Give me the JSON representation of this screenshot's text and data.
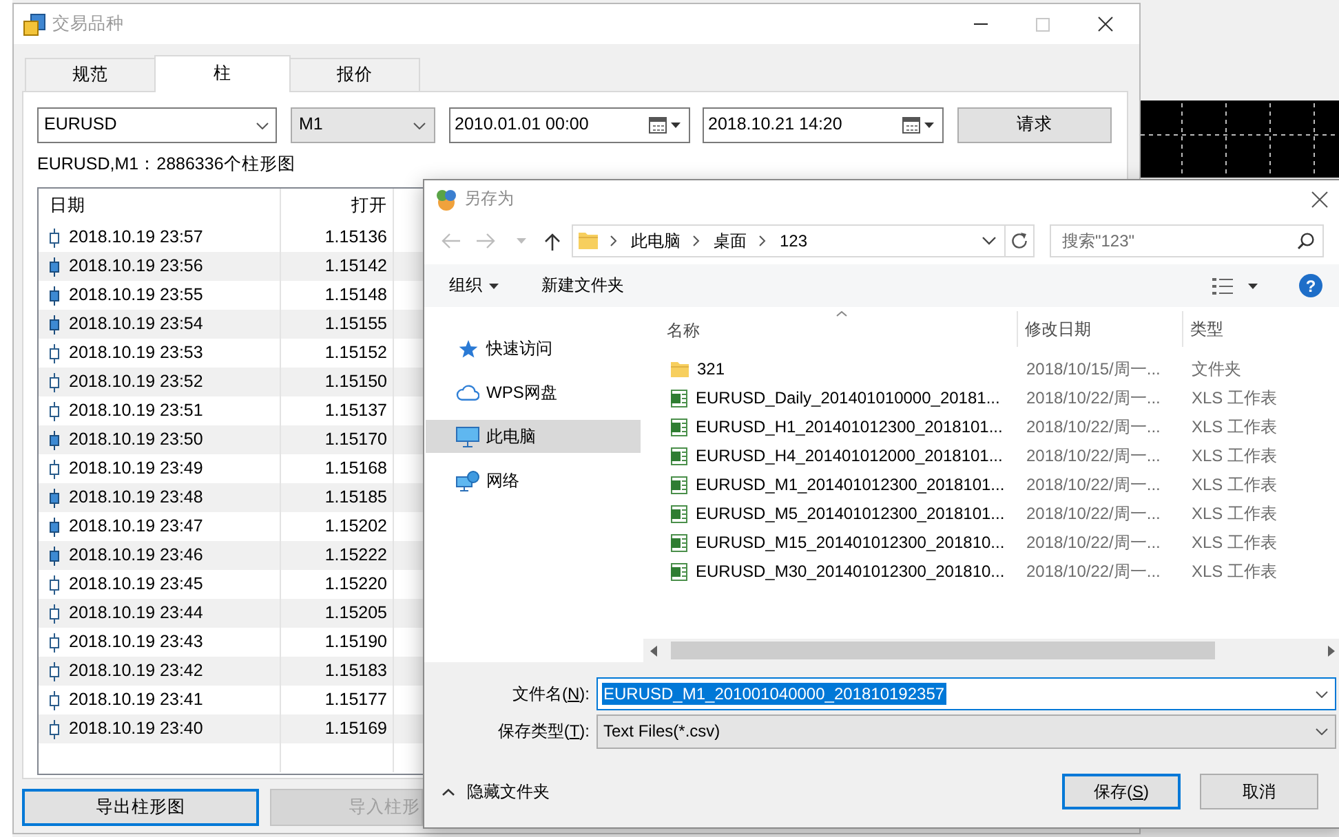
{
  "symbols_dialog": {
    "title": "交易品种",
    "tabs": [
      {
        "label": "规范",
        "selected": false
      },
      {
        "label": "柱",
        "selected": true
      },
      {
        "label": "报价",
        "selected": false
      }
    ],
    "symbol": "EURUSD",
    "timeframe": "M1",
    "date_from": "2010.01.01 00:00",
    "date_to": "2018.10.21 14:20",
    "request_button": "请求",
    "summary": "EURUSD,M1：2886336个柱形图",
    "table": {
      "columns": [
        "日期",
        "打开"
      ],
      "rows": [
        {
          "date": "2018.10.19 23:57",
          "open": "1.15136",
          "filled": false,
          "selected": false
        },
        {
          "date": "2018.10.19 23:56",
          "open": "1.15142",
          "filled": true,
          "selected": false
        },
        {
          "date": "2018.10.19 23:55",
          "open": "1.15148",
          "filled": true,
          "selected": false
        },
        {
          "date": "2018.10.19 23:54",
          "open": "1.15155",
          "filled": true,
          "selected": false
        },
        {
          "date": "2018.10.19 23:53",
          "open": "1.15152",
          "filled": false,
          "selected": false
        },
        {
          "date": "2018.10.19 23:52",
          "open": "1.15150",
          "filled": false,
          "selected": false
        },
        {
          "date": "2018.10.19 23:51",
          "open": "1.15137",
          "filled": false,
          "selected": false
        },
        {
          "date": "2018.10.19 23:50",
          "open": "1.15170",
          "filled": true,
          "selected": false
        },
        {
          "date": "2018.10.19 23:49",
          "open": "1.15168",
          "filled": false,
          "selected": false
        },
        {
          "date": "2018.10.19 23:48",
          "open": "1.15185",
          "filled": true,
          "selected": false
        },
        {
          "date": "2018.10.19 23:47",
          "open": "1.15202",
          "filled": true,
          "selected": false
        },
        {
          "date": "2018.10.19 23:46",
          "open": "1.15222",
          "filled": true,
          "selected": false
        },
        {
          "date": "2018.10.19 23:45",
          "open": "1.15220",
          "filled": false,
          "selected": false
        },
        {
          "date": "2018.10.19 23:44",
          "open": "1.15205",
          "filled": false,
          "selected": false
        },
        {
          "date": "2018.10.19 23:43",
          "open": "1.15190",
          "filled": false,
          "selected": false
        },
        {
          "date": "2018.10.19 23:42",
          "open": "1.15183",
          "filled": false,
          "selected": false
        },
        {
          "date": "2018.10.19 23:41",
          "open": "1.15177",
          "filled": false,
          "selected": false
        },
        {
          "date": "2018.10.19 23:40",
          "open": "1.15169",
          "filled": false,
          "selected": false
        }
      ]
    },
    "buttons": [
      {
        "label": "导出柱形图",
        "focused": true,
        "disabled": false
      },
      {
        "label": "导入柱形",
        "focused": false,
        "disabled": true
      }
    ]
  },
  "save_dialog": {
    "title": "另存为",
    "path": [
      "此电脑",
      "桌面",
      "123"
    ],
    "search": {
      "placeholder": "搜索\"123\""
    },
    "toolbar": {
      "organize": "组织",
      "new_folder": "新建文件夹",
      "help": "?"
    },
    "nav": [
      {
        "label": "快速访问",
        "kind": "star",
        "selected": false
      },
      {
        "label": "WPS网盘",
        "kind": "cloud",
        "selected": false
      },
      {
        "label": "此电脑",
        "kind": "computer",
        "selected": true
      },
      {
        "label": "网络",
        "kind": "network",
        "selected": false
      }
    ],
    "columns": [
      "名称",
      "修改日期",
      "类型"
    ],
    "files": [
      {
        "kind": "folder",
        "name": "321",
        "modified": "2018/10/15/周一...",
        "type": "文件夹"
      },
      {
        "kind": "spreadsheet",
        "name": "EURUSD_Daily_201401010000_20181...",
        "modified": "2018/10/22/周一...",
        "type": "XLS 工作表"
      },
      {
        "kind": "spreadsheet",
        "name": "EURUSD_H1_201401012300_2018101...",
        "modified": "2018/10/22/周一...",
        "type": "XLS 工作表"
      },
      {
        "kind": "spreadsheet",
        "name": "EURUSD_H4_201401012000_2018101...",
        "modified": "2018/10/22/周一...",
        "type": "XLS 工作表"
      },
      {
        "kind": "spreadsheet",
        "name": "EURUSD_M1_201401012300_2018101...",
        "modified": "2018/10/22/周一...",
        "type": "XLS 工作表"
      },
      {
        "kind": "spreadsheet",
        "name": "EURUSD_M5_201401012300_2018101...",
        "modified": "2018/10/22/周一...",
        "type": "XLS 工作表"
      },
      {
        "kind": "spreadsheet",
        "name": "EURUSD_M15_201401012300_201810...",
        "modified": "2018/10/22/周一...",
        "type": "XLS 工作表"
      },
      {
        "kind": "spreadsheet",
        "name": "EURUSD_M30_201401012300_201810...",
        "modified": "2018/10/22/周一...",
        "type": "XLS 工作表"
      }
    ],
    "file_name": {
      "label_start": "文件名(",
      "access_key": "N",
      "label_end": "):",
      "value": "EURUSD_M1_201001040000_201810192357",
      "value_selected": true
    },
    "file_type": {
      "label_start": "保存类型(",
      "access_key": "T",
      "label_end": "):",
      "value": "Text Files(*.csv)"
    },
    "hide_folders": "隐藏文件夹",
    "save_button": {
      "label_start": "保存(",
      "access_key": "S",
      "label_end": ")",
      "focused": true
    },
    "cancel_button": {
      "label": "取消",
      "focused": false
    }
  }
}
